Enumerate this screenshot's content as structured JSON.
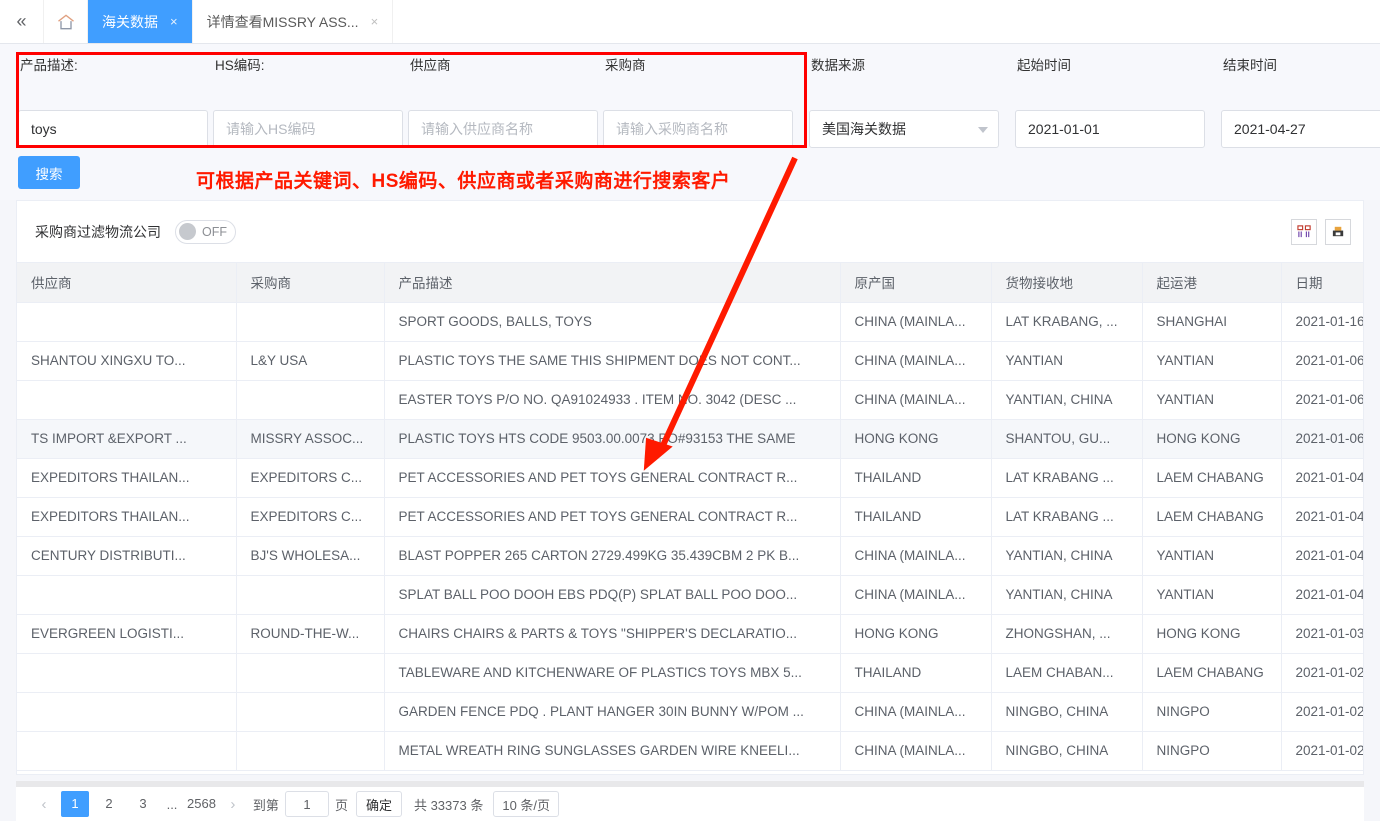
{
  "tabbar": {
    "collapse_icon": "chevron-double-left-icon",
    "home_icon": "home-icon",
    "tabs": [
      {
        "label": "海关数据",
        "close": "×",
        "active": true
      },
      {
        "label": "详情查看MISSRY ASS...",
        "close": "×",
        "active": false
      }
    ]
  },
  "search": {
    "fields": [
      {
        "label": "产品描述:",
        "value": "toys",
        "placeholder": ""
      },
      {
        "label": "HS编码:",
        "value": "",
        "placeholder": "请输入HS编码"
      },
      {
        "label": "供应商",
        "value": "",
        "placeholder": "请输入供应商名称"
      },
      {
        "label": "采购商",
        "value": "",
        "placeholder": "请输入采购商名称"
      }
    ],
    "source": {
      "label": "数据来源",
      "value": "美国海关数据"
    },
    "start_date": {
      "label": "起始时间",
      "value": "2021-01-01"
    },
    "end_date": {
      "label": "结束时间",
      "value": "2021-04-27"
    },
    "search_button": "搜索"
  },
  "annotation": {
    "text": "可根据产品关键词、HS编码、供应商或者采购商进行搜索客户",
    "color": "#ff1a00",
    "box_color": "#ff0000"
  },
  "toolbar": {
    "filter_label": "采购商过滤物流公司",
    "switch_state": "OFF",
    "icons": [
      "columns-settings-icon",
      "export-icon"
    ]
  },
  "table": {
    "columns": [
      "供应商",
      "采购商",
      "产品描述",
      "原产国",
      "货物接收地",
      "起运港",
      "日期"
    ],
    "rows": [
      {
        "supplier": "",
        "buyer": "",
        "desc": "SPORT GOODS, BALLS, TOYS",
        "origin": "CHINA (MAINLA...",
        "receipt": "LAT KRABANG, ...",
        "port": "SHANGHAI",
        "date": "2021-01-16"
      },
      {
        "supplier": "SHANTOU XINGXU TO...",
        "buyer": "L&Y USA",
        "desc": "PLASTIC TOYS THE SAME THIS SHIPMENT DOES NOT CONT...",
        "origin": "CHINA (MAINLA...",
        "receipt": "YANTIAN",
        "port": "YANTIAN",
        "date": "2021-01-06"
      },
      {
        "supplier": "",
        "buyer": "",
        "desc": "EASTER TOYS P/O NO. QA91024933 . ITEM NO. 3042 (DESC ...",
        "origin": "CHINA (MAINLA...",
        "receipt": "YANTIAN, CHINA",
        "port": "YANTIAN",
        "date": "2021-01-06"
      },
      {
        "supplier": "TS IMPORT &EXPORT ...",
        "buyer": "MISSRY ASSOC...",
        "desc": "PLASTIC TOYS HTS CODE 9503.00.0073 PO#93153 THE SAME",
        "origin": "HONG KONG",
        "receipt": "SHANTOU, GU...",
        "port": "HONG KONG",
        "date": "2021-01-06"
      },
      {
        "supplier": "EXPEDITORS THAILAN...",
        "buyer": "EXPEDITORS C...",
        "desc": "PET ACCESSORIES AND PET TOYS GENERAL CONTRACT R...",
        "origin": "THAILAND",
        "receipt": "LAT KRABANG ...",
        "port": "LAEM CHABANG",
        "date": "2021-01-04"
      },
      {
        "supplier": "EXPEDITORS THAILAN...",
        "buyer": "EXPEDITORS C...",
        "desc": "PET ACCESSORIES AND PET TOYS GENERAL CONTRACT R...",
        "origin": "THAILAND",
        "receipt": "LAT KRABANG ...",
        "port": "LAEM CHABANG",
        "date": "2021-01-04"
      },
      {
        "supplier": "CENTURY DISTRIBUTI...",
        "buyer": "BJ'S WHOLESA...",
        "desc": "BLAST POPPER 265 CARTON 2729.499KG 35.439CBM 2 PK B...",
        "origin": "CHINA (MAINLA...",
        "receipt": "YANTIAN, CHINA",
        "port": "YANTIAN",
        "date": "2021-01-04"
      },
      {
        "supplier": "",
        "buyer": "",
        "desc": "SPLAT BALL POO DOOH EBS PDQ(P) SPLAT BALL POO DOO...",
        "origin": "CHINA (MAINLA...",
        "receipt": "YANTIAN, CHINA",
        "port": "YANTIAN",
        "date": "2021-01-04"
      },
      {
        "supplier": "EVERGREEN LOGISTI...",
        "buyer": "ROUND-THE-W...",
        "desc": "CHAIRS CHAIRS & PARTS & TOYS \"SHIPPER'S DECLARATIO...",
        "origin": "HONG KONG",
        "receipt": "ZHONGSHAN, ...",
        "port": "HONG KONG",
        "date": "2021-01-03"
      },
      {
        "supplier": "",
        "buyer": "",
        "desc": "TABLEWARE AND KITCHENWARE OF PLASTICS TOYS MBX 5...",
        "origin": "THAILAND",
        "receipt": "LAEM CHABAN...",
        "port": "LAEM CHABANG",
        "date": "2021-01-02"
      },
      {
        "supplier": "",
        "buyer": "",
        "desc": "GARDEN FENCE PDQ . PLANT HANGER 30IN BUNNY W/POM ...",
        "origin": "CHINA (MAINLA...",
        "receipt": "NINGBO, CHINA",
        "port": "NINGPO",
        "date": "2021-01-02"
      },
      {
        "supplier": "",
        "buyer": "",
        "desc": "METAL WREATH RING SUNGLASSES GARDEN WIRE KNEELI...",
        "origin": "CHINA (MAINLA...",
        "receipt": "NINGBO, CHINA",
        "port": "NINGPO",
        "date": "2021-01-02"
      }
    ]
  },
  "pagination": {
    "prev": "‹",
    "next": "›",
    "pages": [
      "1",
      "2",
      "3"
    ],
    "ellipsis": "...",
    "last_page": "2568",
    "jump_prefix": "到第",
    "jump_value": "1",
    "jump_suffix": "页",
    "confirm": "确定",
    "total": "共 33373 条",
    "page_size": "10 条/页"
  }
}
